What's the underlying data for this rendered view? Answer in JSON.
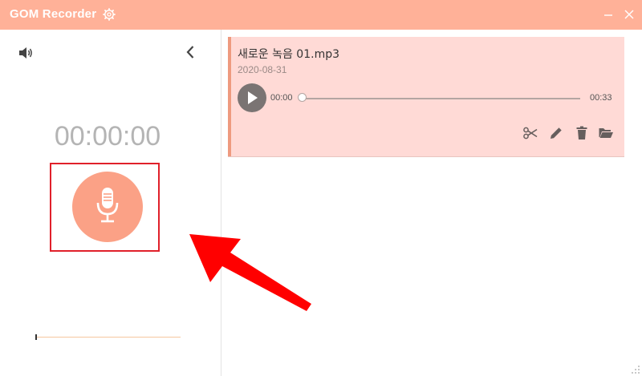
{
  "window": {
    "title": "GOM Recorder",
    "accent_color": "#ffb198",
    "icons": [
      "gear-icon",
      "minimize-icon",
      "close-icon"
    ]
  },
  "left_panel": {
    "icons": [
      "speaker-icon",
      "chevron-left-icon",
      "microphone-icon"
    ],
    "timer": "00:00:00",
    "record_button_color": "#fba186",
    "highlight_color": "#e0202a"
  },
  "recordings": [
    {
      "name": "새로운 녹음 01.mp3",
      "date": "2020-08-31",
      "current_time": "00:00",
      "duration": "00:33",
      "progress": 0,
      "icons": [
        "play-icon",
        "scissors-icon",
        "pencil-icon",
        "trash-icon",
        "folder-open-icon"
      ]
    }
  ]
}
